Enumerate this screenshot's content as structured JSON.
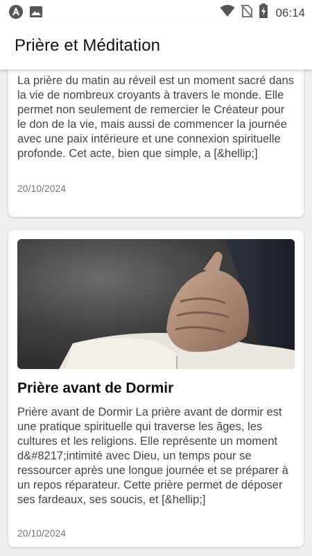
{
  "status_bar": {
    "time": "06:14",
    "icons": [
      "app-logo-icon",
      "image-icon",
      "wifi-icon",
      "no-sim-icon",
      "battery-charging-icon"
    ]
  },
  "app_bar": {
    "title": "Prière et Méditation"
  },
  "posts": [
    {
      "excerpt": "La prière du matin au réveil est un moment sacré dans la vie de nombreux croyants à travers le monde. Elle permet non seulement de remercier le Créateur pour le don de la vie, mais aussi de commencer la journée avec une paix intérieure et une connexion spirituelle profonde. Cet acte, bien que simple, a [&hellip;]",
      "date": "20/10/2024"
    },
    {
      "image": "praying-hands-on-bible",
      "title": "Prière avant de Dormir",
      "excerpt": "Prière avant de Dormir La prière avant de dormir est une pratique spirituelle qui traverse les âges, les cultures et les religions. Elle représente un moment d&#8217;intimité avec Dieu, un temps pour se ressourcer après une longue journée et se préparer à un repos réparateur. Cette prière permet de déposer ses fardeaux, ses soucis, et [&hellip;]",
      "date": "20/10/2024"
    }
  ],
  "colors": {
    "background": "#efefef",
    "card": "#ffffff",
    "text": "#444444",
    "title": "#111111"
  }
}
